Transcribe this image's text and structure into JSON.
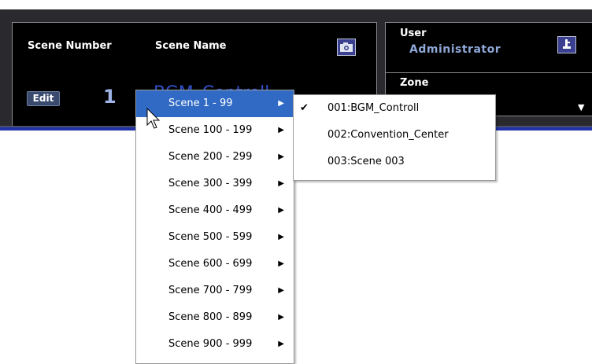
{
  "header": {
    "scene_number_label": "Scene Number",
    "scene_name_label": "Scene Name",
    "edit_button": "Edit",
    "scene_number_value": "1",
    "scene_name_value": "BGM_Controll",
    "user_label": "User",
    "user_value": "Administrator",
    "zone_label": "Zone"
  },
  "menu": {
    "items": [
      {
        "label": "Scene 1 - 99"
      },
      {
        "label": "Scene 100 - 199"
      },
      {
        "label": "Scene 200 - 299"
      },
      {
        "label": "Scene 300 - 399"
      },
      {
        "label": "Scene 400 - 499"
      },
      {
        "label": "Scene 500 - 599"
      },
      {
        "label": "Scene 600 - 699"
      },
      {
        "label": "Scene 700 - 799"
      },
      {
        "label": "Scene 800 - 899"
      },
      {
        "label": "Scene 900 - 999"
      }
    ]
  },
  "submenu": {
    "items": [
      {
        "label": "001:BGM_Controll",
        "checked": true
      },
      {
        "label": "002:Convention_Center",
        "checked": false
      },
      {
        "label": "003:Scene 003",
        "checked": false
      }
    ]
  },
  "colors": {
    "header_bg": "#2a2a2e",
    "panel_bg": "#000000",
    "highlight": "#316ac5",
    "scene_name_text": "#3050c8",
    "user_value_text": "#8fa8d8",
    "divider_blue": "#2233a8"
  },
  "icons": {
    "camera": "camera-icon",
    "user_key": "key-icon",
    "zone_dropdown": "chevron-down-icon",
    "submenu_arrow": "chevron-right-icon",
    "check": "check-icon",
    "cursor": "mouse-cursor-icon"
  }
}
